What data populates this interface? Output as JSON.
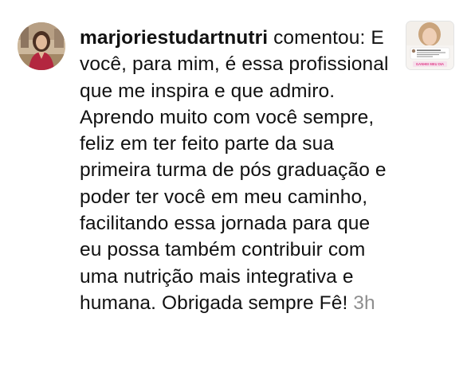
{
  "comment": {
    "username": "marjoriestudartnutri",
    "action": "comentou:",
    "text": "E você, para mim, é essa profissional que me inspira e que admiro. Aprendo muito com você sempre, feliz em ter feito parte da sua primeira turma de pós graduação e poder ter você em meu caminho, facilitando essa jornada para que eu possa também contribuir com uma nutrição mais integrativa e humana. Obrigada sempre Fê!",
    "time": "3h"
  },
  "post_thumbnail": {
    "caption": "GANHEI MEU DIA"
  },
  "colors": {
    "text": "#111111",
    "muted": "#8e8e8e",
    "pink": "#e2438c"
  }
}
